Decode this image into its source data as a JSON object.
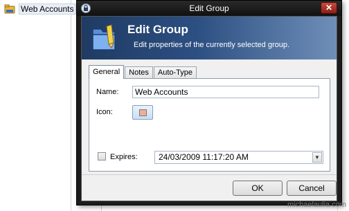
{
  "background": {
    "tree_item_label": "Web Accounts"
  },
  "dialog": {
    "title": "Edit Group",
    "close_label": "✕",
    "banner": {
      "title": "Edit Group",
      "subtitle": "Edit properties of the currently selected group."
    },
    "tabs": [
      {
        "label": "General",
        "active": true
      },
      {
        "label": "Notes",
        "active": false
      },
      {
        "label": "Auto-Type",
        "active": false
      }
    ],
    "general": {
      "name_label": "Name:",
      "name_value": "Web Accounts",
      "icon_label": "Icon:",
      "expires_label": "Expires:",
      "expires_checked": false,
      "expires_value": "24/03/2009 11:17:20 AM",
      "dropdown_arrow": "▼"
    },
    "buttons": {
      "ok": "OK",
      "cancel": "Cancel"
    }
  },
  "watermark": "michaelaulia.com",
  "colors": {
    "banner_start": "#1f3b63",
    "banner_end": "#6f8fb8",
    "titlebar": "#1c1c1c",
    "close_button": "#c84a3e"
  },
  "icons": [
    "folder-icon",
    "lock-icon",
    "close-icon",
    "group-icon",
    "chevron-down-icon"
  ]
}
